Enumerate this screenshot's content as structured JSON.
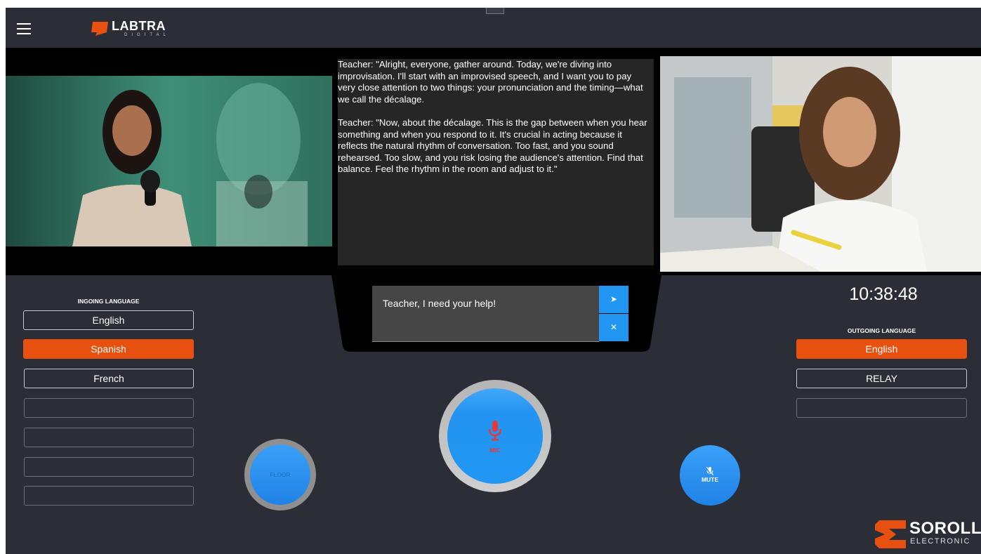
{
  "header": {
    "brand_name": "LABTRA",
    "brand_sub": "DIGITAL",
    "menu_icon": "hamburger-menu-icon",
    "drag_handle_icon": "drag-handle-icon"
  },
  "transcript": {
    "paragraphs": [
      "Teacher: \"Alright, everyone, gather around. Today, we're diving into improvisation. I'll start with an improvised speech, and I want you to pay very close attention to two things: your pronunciation and the timing—what we call the décalage.",
      "Teacher: \"Now, about the décalage. This is the gap between when you hear something and when you respond to it. It's crucial in acting because it reflects the natural rhythm of conversation. Too fast, and you sound rehearsed. Too slow, and you risk losing the audience's attention. Find that balance. Feel the rhythm in the room and adjust to it.\""
    ]
  },
  "chat": {
    "message": "Teacher, I need your help!",
    "send_icon": "send-icon",
    "clear_icon": "close-icon",
    "send_glyph": "➤",
    "clear_glyph": "✕"
  },
  "ingoing": {
    "heading": "INGOING LANGUAGE",
    "options": [
      "English",
      "Spanish",
      "French",
      "",
      "",
      "",
      ""
    ],
    "selected": "Spanish"
  },
  "outgoing": {
    "heading": "OUTGOING LANGUAGE",
    "options": [
      "English",
      "RELAY",
      ""
    ],
    "selected": "English"
  },
  "clock": "10:38:48",
  "controls": {
    "floor_label": "FLOOR",
    "mic_label": "MIC",
    "mute_label": "MUTE",
    "mic_icon": "microphone-icon",
    "mute_icon": "microphone-off-icon"
  },
  "footer_brand": {
    "name": "SOROLL",
    "sub": "ELECTRONIC"
  },
  "colors": {
    "background": "#2b2e37",
    "accent_orange": "#e8500f",
    "button_blue": "#2196f3",
    "mic_red": "#e53935"
  }
}
